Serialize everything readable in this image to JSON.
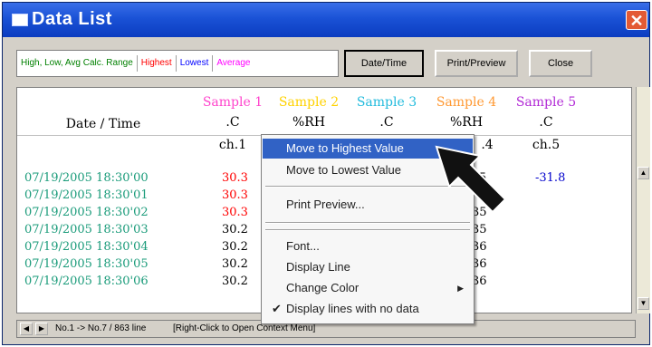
{
  "window": {
    "title": "Data List",
    "close_glyph": "✕"
  },
  "toolbar": {
    "legend": {
      "range": "High, Low, Avg Calc. Range",
      "highest": "Highest",
      "lowest": "Lowest",
      "average": "Average"
    },
    "datetime_button": "Date/Time",
    "print_preview_button": "Print/Preview",
    "close_button": "Close"
  },
  "colors": {
    "highest": "#ff0000",
    "lowest": "#0000ff",
    "average": "#ff00ff",
    "range": "#008000",
    "menu_selection": "#3162c5",
    "title_bar": "#1a52d6"
  },
  "grid": {
    "datetime_header": "Date / Time",
    "columns": [
      {
        "sample": "Sample 1",
        "unit": ".C",
        "channel": "ch.1",
        "color": "#ff44cc"
      },
      {
        "sample": "Sample 2",
        "unit": "%RH",
        "channel": "",
        "color": "#ffd200"
      },
      {
        "sample": "Sample 3",
        "unit": ".C",
        "channel": "",
        "color": "#22bbdd"
      },
      {
        "sample": "Sample 4",
        "unit": "%RH",
        "channel": ".4",
        "color": "#ff9933"
      },
      {
        "sample": "Sample 5",
        "unit": ".C",
        "channel": "ch.5",
        "color": "#b22ad6"
      }
    ],
    "rows": [
      {
        "datetime": "07/19/2005 18:30'00",
        "s1": "30.3",
        "s4": "5",
        "s5": "-31.8"
      },
      {
        "datetime": "07/19/2005 18:30'01",
        "s1": "30.3",
        "s4": "",
        "s5": ""
      },
      {
        "datetime": "07/19/2005 18:30'02",
        "s1": "30.3",
        "s4": "35",
        "s5": ""
      },
      {
        "datetime": "07/19/2005 18:30'03",
        "s1": "30.2",
        "s4": "35",
        "s5": ""
      },
      {
        "datetime": "07/19/2005 18:30'04",
        "s1": "30.2",
        "s4": "36",
        "s5": ""
      },
      {
        "datetime": "07/19/2005 18:30'05",
        "s1": "30.2",
        "s4": "36",
        "s5": ""
      },
      {
        "datetime": "07/19/2005 18:30'06",
        "s1": "30.2",
        "s4": "36",
        "s5": ""
      }
    ]
  },
  "status": {
    "line_info": "No.1 -> No.7 / 863 line",
    "hint": "[Right-Click to Open Context Menu]"
  },
  "context_menu": {
    "items": [
      {
        "label": "Move to Highest Value",
        "selected": true
      },
      {
        "label": "Move to Lowest Value"
      },
      {
        "label": "Print Preview..."
      },
      {
        "label": "Font..."
      },
      {
        "label": "Display Line"
      },
      {
        "label": "Change Color",
        "submenu": true
      },
      {
        "label": "Display lines with no data",
        "checked": true
      }
    ]
  }
}
